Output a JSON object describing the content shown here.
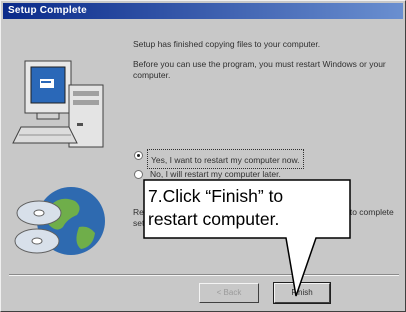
{
  "window": {
    "title": "Setup Complete"
  },
  "body": {
    "paragraph1": "Setup has finished copying files to your computer.",
    "paragraph2": "Before you can use the program, you must restart Windows or your computer."
  },
  "options": [
    {
      "label": "Yes, I want to restart my computer now.",
      "selected": true
    },
    {
      "label": "No, I will restart my computer later.",
      "selected": false
    }
  ],
  "footer_note": "Remove any disks from their drives, and then click Finish to complete setup.",
  "buttons": {
    "back": "< Back",
    "finish": "Finish"
  },
  "callout": {
    "line1": "7.Click “Finish” to",
    "line2": "restart computer."
  }
}
